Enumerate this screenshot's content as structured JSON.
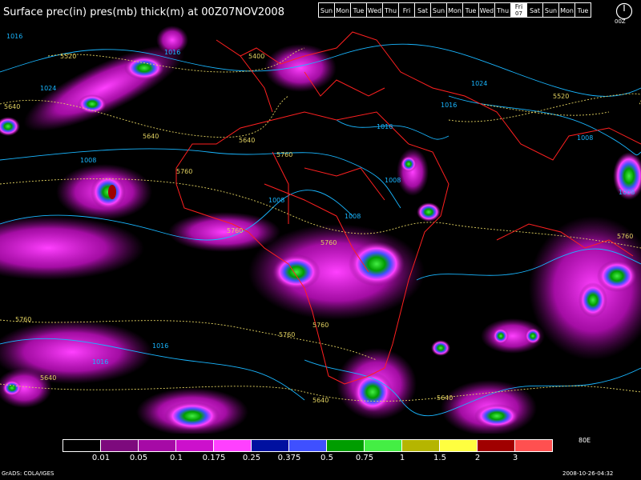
{
  "title": "Surface prec(in) pres(mb) thick(m) at 00Z07NOV2008",
  "days": [
    "Sun",
    "Mon",
    "Tue",
    "Wed",
    "Thu",
    "Fri",
    "Sat",
    "Sun",
    "Mon",
    "Tue",
    "Wed",
    "Thu",
    "Fri",
    "Sat",
    "Sun",
    "Mon",
    "Tue"
  ],
  "active_day_index": 12,
  "active_day_sub": "07",
  "clock_icon": "clock-icon",
  "clock_label": "00Z",
  "colorbar": {
    "colors": [
      "#000000",
      "#7d0a7d",
      "#a60aa6",
      "#cc10cc",
      "#ff40ff",
      "#0010a0",
      "#3f50ff",
      "#009d00",
      "#44ee44",
      "#b5b500",
      "#ffff40",
      "#a00000",
      "#ff5050"
    ],
    "ticks": [
      "0.01",
      "0.05",
      "0.1",
      "0.175",
      "0.25",
      "0.375",
      "0.5",
      "0.75",
      "1",
      "1.5",
      "2",
      "3"
    ],
    "right_label": "80E"
  },
  "pressure_labels": [
    "1016",
    "1024",
    "1016",
    "1008",
    "1008",
    "1016",
    "1008",
    "1008",
    "1024",
    "1016",
    "1008",
    "1008",
    "1016",
    "1016"
  ],
  "thickness_labels": [
    "5520",
    "5640",
    "5400",
    "5640",
    "5760",
    "5640",
    "5760",
    "5760",
    "5760",
    "5760",
    "5760",
    "5640",
    "5640",
    "5640",
    "5520",
    "5760",
    "5760"
  ],
  "footer_left": "GrADS: COLA/IGES",
  "footer_right": "2008-10-26-04:32",
  "colors": {
    "coast": "#ff2020",
    "pressure": "#19b6ff",
    "thickness": "#e0d060"
  }
}
